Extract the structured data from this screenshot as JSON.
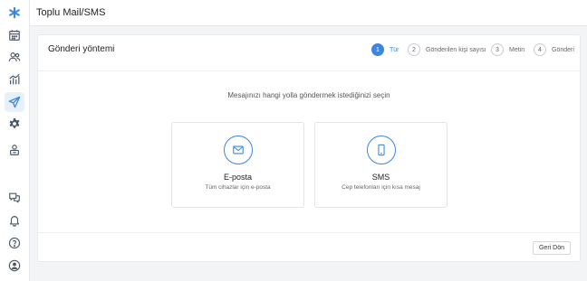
{
  "app": {
    "title": "Toplu Mail/SMS"
  },
  "sidebar": {
    "items": [
      {
        "icon": "logo-icon"
      },
      {
        "icon": "calendar-icon"
      },
      {
        "icon": "users-icon"
      },
      {
        "icon": "chart-icon"
      },
      {
        "icon": "send-icon",
        "active": true
      },
      {
        "icon": "gear-icon"
      },
      {
        "icon": "user-badge-icon"
      },
      {
        "icon": "chat-icon"
      },
      {
        "icon": "bell-icon"
      },
      {
        "icon": "help-icon"
      },
      {
        "icon": "profile-icon"
      }
    ]
  },
  "card": {
    "title": "Gönderi yöntemi"
  },
  "steps": [
    {
      "num": "1",
      "label": "Tür",
      "active": true
    },
    {
      "num": "2",
      "label": "Gönderilen kişi sayısı"
    },
    {
      "num": "3",
      "label": "Metin"
    },
    {
      "num": "4",
      "label": "Gönderi"
    }
  ],
  "question": "Mesajınızı hangi yolla göndermek istediğinizi seçin",
  "options": {
    "email": {
      "title": "E-posta",
      "subtitle": "Tüm cihazlar için e-posta",
      "icon": "envelope-icon"
    },
    "sms": {
      "title": "SMS",
      "subtitle": "Cep telefonları için kısa mesaj",
      "icon": "phone-icon"
    }
  },
  "footer": {
    "back_label": "Geri Dön"
  },
  "colors": {
    "accent": "#3a86e0",
    "icon": "#4a5866",
    "background": "#f3f4f6"
  }
}
